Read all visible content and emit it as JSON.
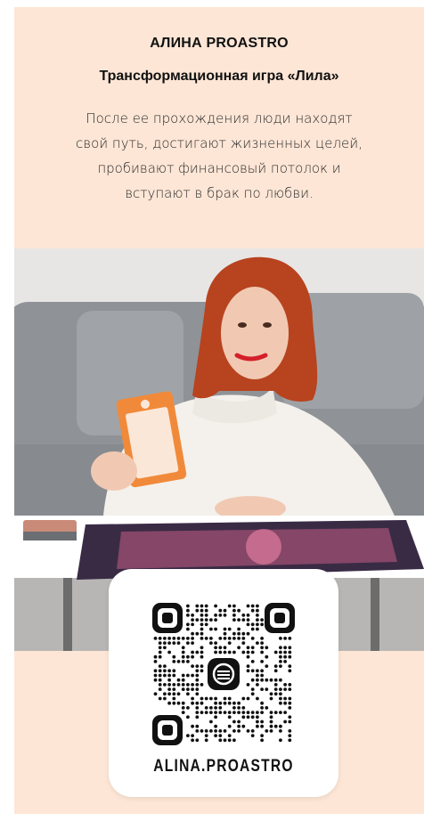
{
  "header": {
    "name": "АЛИНА PROASTRO",
    "subtitle": "Трансформационная игра «Лила»",
    "description_lines": [
      "После ее прохождения люди находят",
      "свой путь, достигают жизненных целей,",
      "пробивают финансовый потолок и",
      "вступают в брак по любви."
    ]
  },
  "photo": {
    "icon": "photo-of-woman-with-game-cards"
  },
  "qr": {
    "handle": "ALINA.PROASTRO",
    "icon": "instagram-qr-code"
  },
  "colors": {
    "background": "#fde6d6",
    "text": "#111111",
    "qr_card": "#ffffff"
  }
}
